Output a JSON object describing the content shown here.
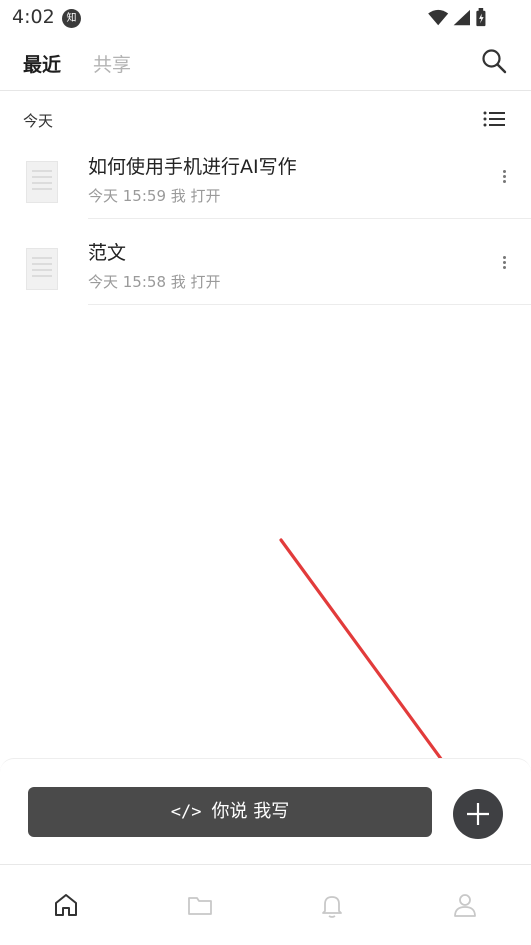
{
  "status_bar": {
    "time": "4:02",
    "notification_badge": "知"
  },
  "tabs": [
    {
      "label": "最近",
      "active": true
    },
    {
      "label": "共享",
      "active": false
    }
  ],
  "section_header": "今天",
  "files": [
    {
      "title": "如何使用手机进行AI写作",
      "meta": "今天 15:59 我 打开"
    },
    {
      "title": "范文",
      "meta": "今天 15:58 我 打开"
    }
  ],
  "action_panel": {
    "ai_write_code_glyph": "</>",
    "ai_write_label": "你说 我写"
  },
  "bottom_nav": [
    "home-icon",
    "folder-icon",
    "bell-icon",
    "profile-icon"
  ],
  "colors": {
    "accent_dark": "#4a4a4a",
    "annotation_arrow": "#e23b3b"
  }
}
